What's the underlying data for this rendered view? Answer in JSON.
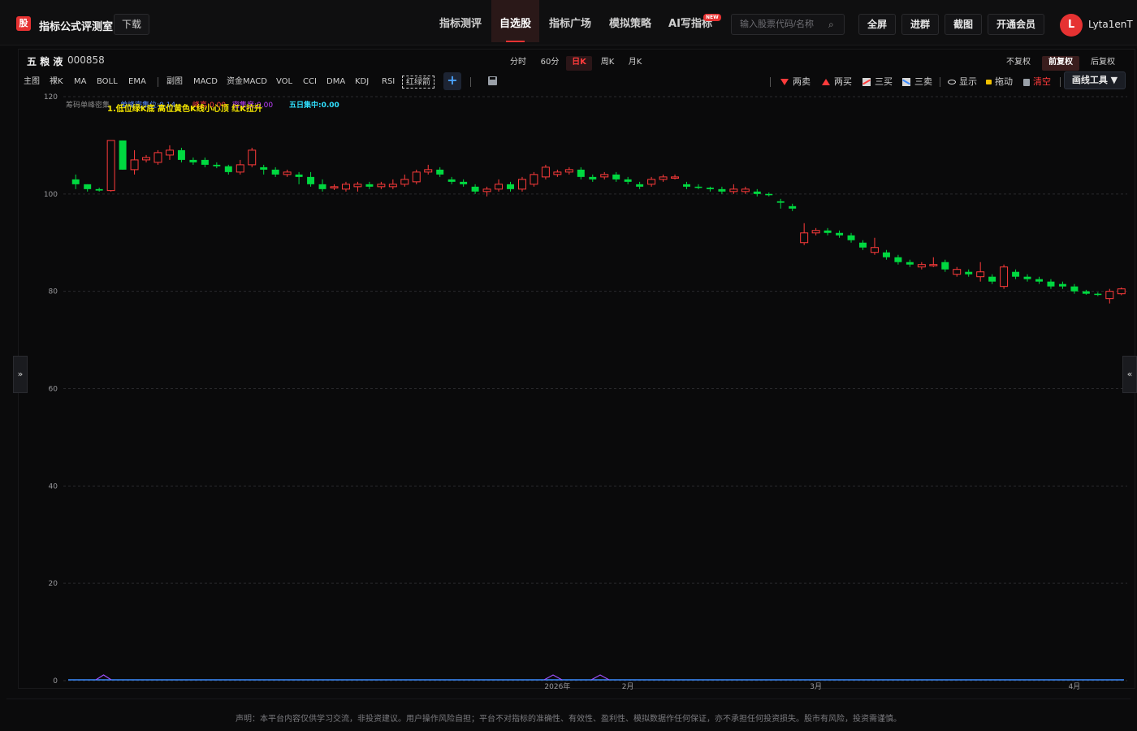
{
  "header": {
    "logo": "股",
    "brand": "指标公式评测室",
    "download": "下载",
    "nav": [
      {
        "label": "指标测评",
        "active": false
      },
      {
        "label": "自选股",
        "active": true
      },
      {
        "label": "指标广场",
        "active": false
      },
      {
        "label": "模拟策略",
        "active": false
      },
      {
        "label": "AI写指标",
        "active": false
      }
    ],
    "new_badge": "NEW",
    "search_placeholder": "输入股票代码/名称",
    "buttons": [
      "全屏",
      "进群",
      "截图",
      "开通会员"
    ],
    "avatar_letter": "L",
    "username": "Lyta1enT"
  },
  "stock": {
    "name": "五 粮 液",
    "code": "000858"
  },
  "periods": [
    {
      "label": "分时",
      "active": false
    },
    {
      "label": "60分",
      "active": false
    },
    {
      "label": "日K",
      "active": true
    },
    {
      "label": "周K",
      "active": false
    },
    {
      "label": "月K",
      "active": false
    }
  ],
  "fuquan": [
    {
      "label": "不复权",
      "active": false
    },
    {
      "label": "前复权",
      "active": true
    },
    {
      "label": "后复权",
      "active": false
    }
  ],
  "indicators": [
    "主图",
    "裸K",
    "MA",
    "BOLL",
    "EMA",
    "副图",
    "MACD",
    "资金MACD",
    "VOL",
    "CCI",
    "DMA",
    "KDJ",
    "RSI",
    "红绿箭"
  ],
  "tools": {
    "two_sell": "两卖",
    "two_buy": "两买",
    "three_buy": "三买",
    "three_sell": "三卖",
    "show": "显示",
    "drag": "拖动",
    "clear": "清空",
    "draw_tools": "画线工具 ▼"
  },
  "legend": {
    "chip_label": "筹码单峰密集",
    "top_text": "1.低位绿K底 高位黄色K线小心顶 红K拉升",
    "items": [
      {
        "label": "单峰密集位:0.14",
        "color": "#5a8cff"
      },
      {
        "label": "峰高:0.00",
        "color": "#ff3b3b"
      },
      {
        "label": "密集度:0.00",
        "color": "#c040ff"
      },
      {
        "label": "五日集中:0.00",
        "color": "#30e0ff"
      }
    ]
  },
  "colors": {
    "up": "#ff3b3b",
    "down": "#00d940",
    "grid": "#2a2a2e",
    "axis_text": "#9a9a9e"
  },
  "chart_data": {
    "type": "candlestick",
    "ylim": [
      0,
      120
    ],
    "yticks": [
      0,
      20,
      40,
      60,
      80,
      100,
      120
    ],
    "xticks": [
      "2026年",
      "2月",
      "3月",
      "4月"
    ],
    "xtick_positions": [
      41,
      47,
      63,
      85
    ],
    "candles": [
      {
        "o": 103,
        "c": 102,
        "h": 104,
        "l": 101
      },
      {
        "o": 102,
        "c": 101,
        "h": 102,
        "l": 100.5
      },
      {
        "o": 101,
        "c": 100.7,
        "h": 101.3,
        "l": 100.5
      },
      {
        "o": 100.7,
        "c": 111,
        "h": 111,
        "l": 100.5
      },
      {
        "o": 111,
        "c": 105,
        "h": 111,
        "l": 105
      },
      {
        "o": 105,
        "c": 107,
        "h": 109,
        "l": 104
      },
      {
        "o": 107,
        "c": 107.5,
        "h": 108,
        "l": 106.5
      },
      {
        "o": 106.5,
        "c": 108.5,
        "h": 109,
        "l": 106
      },
      {
        "o": 108,
        "c": 109,
        "h": 110,
        "l": 107
      },
      {
        "o": 109,
        "c": 107,
        "h": 109.5,
        "l": 106.5
      },
      {
        "o": 107,
        "c": 106.5,
        "h": 107.5,
        "l": 106
      },
      {
        "o": 107,
        "c": 106,
        "h": 107.5,
        "l": 105.5
      },
      {
        "o": 106,
        "c": 105.7,
        "h": 106.5,
        "l": 105.3
      },
      {
        "o": 105.7,
        "c": 104.5,
        "h": 106,
        "l": 104
      },
      {
        "o": 104.5,
        "c": 106,
        "h": 107,
        "l": 104
      },
      {
        "o": 106,
        "c": 109,
        "h": 109.5,
        "l": 105.5
      },
      {
        "o": 105.5,
        "c": 105,
        "h": 106,
        "l": 104
      },
      {
        "o": 105,
        "c": 104,
        "h": 105.5,
        "l": 103.5
      },
      {
        "o": 104,
        "c": 104.5,
        "h": 105,
        "l": 103.5
      },
      {
        "o": 104,
        "c": 103.5,
        "h": 104.5,
        "l": 102
      },
      {
        "o": 103.5,
        "c": 102,
        "h": 104.5,
        "l": 101.5
      },
      {
        "o": 102,
        "c": 101,
        "h": 103,
        "l": 100.5
      },
      {
        "o": 101.5,
        "c": 101.5,
        "h": 102,
        "l": 100.8
      },
      {
        "o": 101,
        "c": 102,
        "h": 102.5,
        "l": 100.5
      },
      {
        "o": 101.5,
        "c": 102,
        "h": 102.5,
        "l": 100.5
      },
      {
        "o": 102,
        "c": 101.5,
        "h": 102.5,
        "l": 101
      },
      {
        "o": 101.5,
        "c": 102,
        "h": 102.5,
        "l": 101
      },
      {
        "o": 101.5,
        "c": 102,
        "h": 103,
        "l": 101
      },
      {
        "o": 102,
        "c": 103,
        "h": 104,
        "l": 101.5
      },
      {
        "o": 102.5,
        "c": 104.5,
        "h": 105,
        "l": 102
      },
      {
        "o": 104.5,
        "c": 105,
        "h": 106,
        "l": 104
      },
      {
        "o": 105,
        "c": 104,
        "h": 105.5,
        "l": 103.5
      },
      {
        "o": 103,
        "c": 102.5,
        "h": 103.5,
        "l": 102
      },
      {
        "o": 102.5,
        "c": 102,
        "h": 103,
        "l": 101.5
      },
      {
        "o": 101.5,
        "c": 100.5,
        "h": 102,
        "l": 100
      },
      {
        "o": 100.5,
        "c": 101,
        "h": 101.5,
        "l": 99.5
      },
      {
        "o": 101,
        "c": 102,
        "h": 103,
        "l": 100.5
      },
      {
        "o": 102,
        "c": 101,
        "h": 102.5,
        "l": 100.5
      },
      {
        "o": 101,
        "c": 103,
        "h": 103.5,
        "l": 100.5
      },
      {
        "o": 102,
        "c": 104,
        "h": 104.5,
        "l": 101.5
      },
      {
        "o": 103.5,
        "c": 105.5,
        "h": 106,
        "l": 103
      },
      {
        "o": 104,
        "c": 104.5,
        "h": 105,
        "l": 103.5
      },
      {
        "o": 104.5,
        "c": 105,
        "h": 105.5,
        "l": 104
      },
      {
        "o": 105,
        "c": 103.5,
        "h": 105.5,
        "l": 103
      },
      {
        "o": 103.5,
        "c": 103,
        "h": 104,
        "l": 102.5
      },
      {
        "o": 103.5,
        "c": 104,
        "h": 104.5,
        "l": 103
      },
      {
        "o": 104,
        "c": 103,
        "h": 104.5,
        "l": 102.5
      },
      {
        "o": 103,
        "c": 102.5,
        "h": 103.5,
        "l": 102
      },
      {
        "o": 102,
        "c": 101.5,
        "h": 102.5,
        "l": 101
      },
      {
        "o": 102,
        "c": 103,
        "h": 103.5,
        "l": 101.5
      },
      {
        "o": 103,
        "c": 103.5,
        "h": 104,
        "l": 102.5
      },
      {
        "o": 103.5,
        "c": 103.5,
        "h": 104,
        "l": 103
      },
      {
        "o": 102,
        "c": 101.5,
        "h": 102.5,
        "l": 101
      },
      {
        "o": 101.5,
        "c": 101.3,
        "h": 102,
        "l": 101
      },
      {
        "o": 101.3,
        "c": 101,
        "h": 101.5,
        "l": 100.5
      },
      {
        "o": 101,
        "c": 100.5,
        "h": 101.5,
        "l": 100
      },
      {
        "o": 100.5,
        "c": 101,
        "h": 102,
        "l": 100
      },
      {
        "o": 100.5,
        "c": 101,
        "h": 101.5,
        "l": 100
      },
      {
        "o": 100.5,
        "c": 100,
        "h": 101,
        "l": 99.5
      },
      {
        "o": 100,
        "c": 99.8,
        "h": 100.3,
        "l": 99.5
      },
      {
        "o": 98.5,
        "c": 98.2,
        "h": 99,
        "l": 97
      },
      {
        "o": 97.5,
        "c": 97,
        "h": 98,
        "l": 96.5
      },
      {
        "o": 90,
        "c": 92,
        "h": 94,
        "l": 89.5
      },
      {
        "o": 92,
        "c": 92.5,
        "h": 93,
        "l": 91.5
      },
      {
        "o": 92.5,
        "c": 92,
        "h": 93,
        "l": 91.5
      },
      {
        "o": 92,
        "c": 91.5,
        "h": 92.5,
        "l": 91
      },
      {
        "o": 91.5,
        "c": 90.5,
        "h": 92,
        "l": 90
      },
      {
        "o": 90,
        "c": 89,
        "h": 90.5,
        "l": 88.5
      },
      {
        "o": 88,
        "c": 89,
        "h": 91,
        "l": 87.5
      },
      {
        "o": 88,
        "c": 87,
        "h": 88.5,
        "l": 86.5
      },
      {
        "o": 87,
        "c": 86,
        "h": 87.5,
        "l": 85.5
      },
      {
        "o": 86,
        "c": 85.5,
        "h": 86.5,
        "l": 85
      },
      {
        "o": 85,
        "c": 85.5,
        "h": 86,
        "l": 84.5
      },
      {
        "o": 85.5,
        "c": 85.5,
        "h": 87,
        "l": 85
      },
      {
        "o": 86,
        "c": 84.5,
        "h": 86.5,
        "l": 84
      },
      {
        "o": 83.5,
        "c": 84.5,
        "h": 85,
        "l": 83
      },
      {
        "o": 84,
        "c": 83.5,
        "h": 84.5,
        "l": 83
      },
      {
        "o": 83,
        "c": 84,
        "h": 86,
        "l": 82
      },
      {
        "o": 83,
        "c": 82,
        "h": 83.5,
        "l": 81.5
      },
      {
        "o": 81,
        "c": 85,
        "h": 85.5,
        "l": 80.5
      },
      {
        "o": 84,
        "c": 83,
        "h": 84.5,
        "l": 82.5
      },
      {
        "o": 83,
        "c": 82.5,
        "h": 83.5,
        "l": 82
      },
      {
        "o": 82.5,
        "c": 82,
        "h": 83,
        "l": 81.5
      },
      {
        "o": 82,
        "c": 81,
        "h": 82.5,
        "l": 80.5
      },
      {
        "o": 81.5,
        "c": 81,
        "h": 82,
        "l": 80.5
      },
      {
        "o": 81,
        "c": 80,
        "h": 81.5,
        "l": 79.5
      },
      {
        "o": 80,
        "c": 79.5,
        "h": 80.3,
        "l": 79.3
      },
      {
        "o": 79.5,
        "c": 79.3,
        "h": 79.8,
        "l": 79
      },
      {
        "o": 78.5,
        "c": 80,
        "h": 80.5,
        "l": 77.5
      },
      {
        "o": 79.5,
        "c": 80.5,
        "h": 80.8,
        "l": 79.2
      }
    ]
  },
  "footer": {
    "disclaimer": "声明：本平台内容仅供学习交流，非投资建议。用户操作风险自担；平台不对指标的准确性、有效性、盈利性、模拟数据作任何保证，亦不承担任何投资损失。股市有风险，投资需谨慎。"
  }
}
